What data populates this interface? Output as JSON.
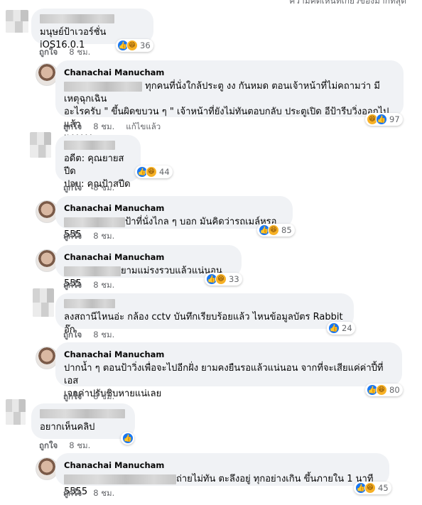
{
  "header": {
    "sort_label": "ความคิดเห็นที่เกี่ยวข้องมากที่สุด"
  },
  "actions": {
    "like": "ถูกใจ",
    "edited": "แก้ไขแล้ว"
  },
  "comments": [
    {
      "author": "",
      "text": "มนุษย์ป้าเวอร์ชั่น iOS16.0.1",
      "time": "8 ชม.",
      "reactions": "36"
    },
    {
      "author": "Chanachai Manucham",
      "text1": " ทุกคนที่นั่งใกล้ประตู งง กันหมด ตอนเจ้าหน้าที่ไม่คถามว่า มีเหตุฉุกเฉิน",
      "text2": "อะไรครับ \" ขึ้นผิดขบวน ๆ \" เจ้าหน้าที่ยังไม่ทันตอบกลับ ประตูเปิด อีป้ารีบวิ่งออกไปแล้ว",
      "text3": "แงงงงง",
      "time": "8 ชม.",
      "reactions": "97"
    },
    {
      "author": "",
      "text1": "อดีต: คุณยายสปีด",
      "text2": "ปจบ: คุณป้าสปีด",
      "time": "8 ชม.",
      "reactions": "44"
    },
    {
      "author": "Chanachai Manucham",
      "text": "ป้าที่นั่งไกล ๆ บอก มันคิดว่ารถเมล์หรอ 555",
      "time": "8 ชม.",
      "reactions": "85"
    },
    {
      "author": "Chanachai Manucham",
      "text": "ยามแม่รงรวบแล้วแน่นอน 555",
      "time": "8 ชม.",
      "reactions": "33"
    },
    {
      "author": "",
      "text": "ลงสถานีไหนอ่ะ กล้อง cctv บันทึกเรียบร้อยแล้ว ไหนข้อมูลบัตร Rabbit อ๊ก",
      "time": "8 ชม.",
      "reactions": "24"
    },
    {
      "author": "Chanachai Manucham",
      "text1": "ปากน้ำ ๆ ตอนป้าวิ่งเพื่อจะไปอีกฝั่ง ยามคงยืนรอแล้วแน่นอน จากที่จะเสียแค่ค่าปี้ที่เอส",
      "text2": "เจอค่าปรับชิบหายแน่เลย",
      "time": "8 ชม.",
      "reactions": "80"
    },
    {
      "author": "",
      "text": "อยากเห็นคลิป",
      "time": "8 ชม.",
      "reactions": ""
    },
    {
      "author": "Chanachai Manucham",
      "text": "ถ่ายไม่ทัน ตะลึงอยู่ ทุกอย่างเกิน ขึ้นภายใน 1 นาที 5555",
      "time": "8 ชม.",
      "reactions": "45"
    }
  ],
  "icons": {
    "like": "like-icon",
    "haha": "haha-icon"
  },
  "colors": {
    "bubble": "#f0f2f5",
    "like": "#1877f2",
    "haha": "#f7b125",
    "meta": "#65676b"
  }
}
